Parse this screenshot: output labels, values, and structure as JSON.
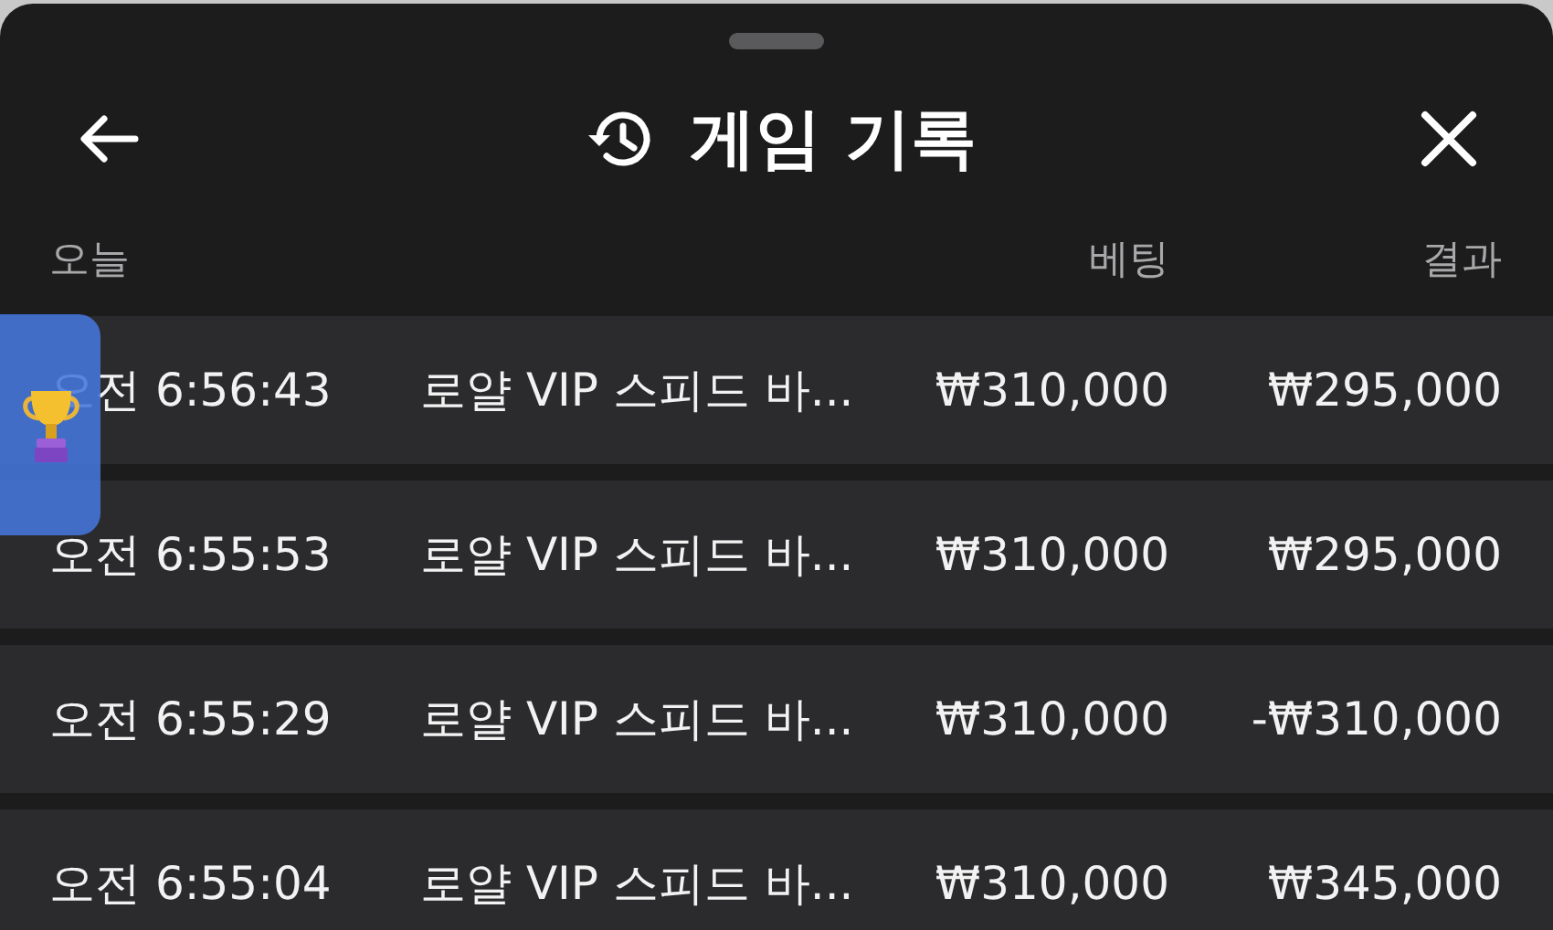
{
  "header": {
    "title": "게임 기록"
  },
  "columns": {
    "date": "오늘",
    "bet": "베팅",
    "result": "결과"
  },
  "rows": [
    {
      "time": "오전 6:56:43",
      "game": "로얄 VIP 스피드 바...",
      "bet": "₩310,000",
      "result": "₩295,000"
    },
    {
      "time": "오전 6:55:53",
      "game": "로얄 VIP 스피드 바...",
      "bet": "₩310,000",
      "result": "₩295,000"
    },
    {
      "time": "오전 6:55:29",
      "game": "로얄 VIP 스피드 바...",
      "bet": "₩310,000",
      "result": "-₩310,000"
    },
    {
      "time": "오전 6:55:04",
      "game": "로얄 VIP 스피드 바...",
      "bet": "₩310,000",
      "result": "₩345,000"
    }
  ]
}
